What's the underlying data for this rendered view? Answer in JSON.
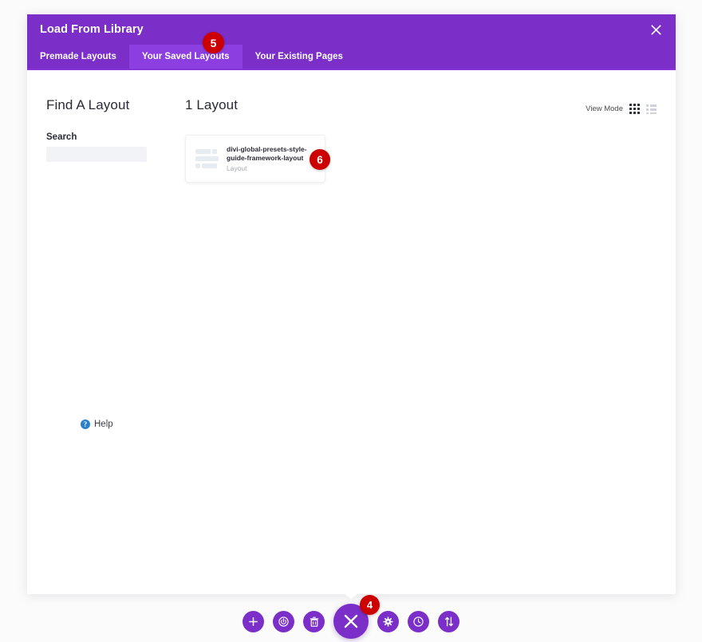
{
  "modal": {
    "title": "Load From Library",
    "close_icon": "close-icon",
    "tabs": [
      {
        "label": "Premade Layouts",
        "active": false
      },
      {
        "label": "Your Saved Layouts",
        "active": true
      },
      {
        "label": "Your Existing Pages",
        "active": false
      }
    ]
  },
  "sidebar": {
    "heading": "Find A Layout",
    "search_label": "Search",
    "search_value": "",
    "search_placeholder": "",
    "help_label": "Help",
    "help_icon": "question-circle-icon"
  },
  "main": {
    "count_title": "1 Layout",
    "view_mode_label": "View Mode",
    "view_mode_grid_icon": "grid-view-icon",
    "view_mode_list_icon": "list-view-icon",
    "view_mode_active": "grid",
    "layouts": [
      {
        "name": "divi-global-presets-style-guide-framework-layout",
        "type": "Layout",
        "thumbnail_icon": "layout-thumbnail-placeholder"
      }
    ]
  },
  "toolbar": {
    "buttons": [
      {
        "name": "add-button",
        "icon": "plus-icon"
      },
      {
        "name": "toggle-builder-button",
        "icon": "power-icon"
      },
      {
        "name": "delete-button",
        "icon": "trash-icon"
      },
      {
        "name": "close-builder-button",
        "icon": "close-x-icon",
        "primary": true
      },
      {
        "name": "settings-button",
        "icon": "gear-icon"
      },
      {
        "name": "history-button",
        "icon": "clock-icon"
      },
      {
        "name": "portability-button",
        "icon": "up-down-arrows-icon"
      }
    ]
  },
  "annotations": [
    {
      "id": "badge5",
      "label": "5"
    },
    {
      "id": "badge6",
      "label": "6"
    },
    {
      "id": "badge4",
      "label": "4"
    }
  ],
  "colors": {
    "brand_purple": "#7b2ec8",
    "tab_active_purple": "#8c3ee0",
    "badge_red": "#cc0000",
    "help_blue": "#2a7fcd"
  }
}
